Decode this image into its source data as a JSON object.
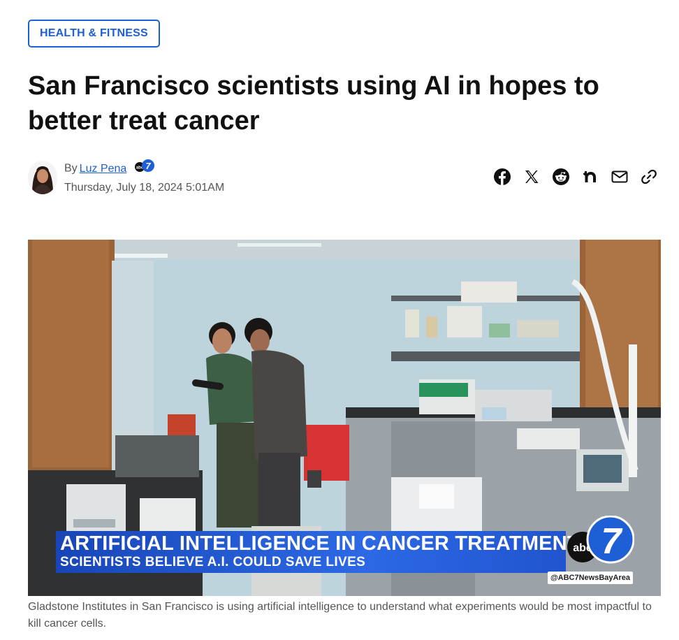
{
  "category": {
    "label": "HEALTH & FITNESS"
  },
  "article": {
    "headline": "San Francisco scientists using AI in hopes to better treat cancer",
    "byline_prefix": "By",
    "author_name": "Luz Pena",
    "dateline": "Thursday, July 18, 2024 5:01AM"
  },
  "share": {
    "icons": [
      "facebook-icon",
      "x-icon",
      "reddit-icon",
      "nextdoor-icon",
      "email-icon",
      "link-icon"
    ]
  },
  "hero": {
    "lower_third_title": "ARTIFICIAL INTELLIGENCE IN CANCER TREATMENT",
    "lower_third_subtitle": "SCIENTISTS BELIEVE A.I. COULD SAVE LIVES",
    "logo_text": "abc",
    "logo_number": "7",
    "handle": "@ABC7NewsBayArea"
  },
  "caption": "Gladstone Institutes in San Francisco is using artificial intelligence to understand what experiments would be most impactful to kill cancer cells.",
  "colors": {
    "accent": "#1f5fd6",
    "lower_third": "#2154cf"
  }
}
